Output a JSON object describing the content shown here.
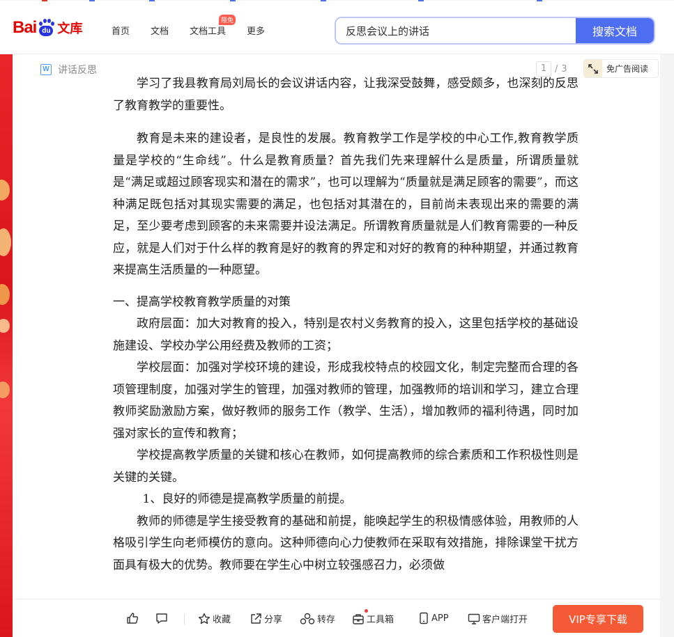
{
  "header": {
    "logo_bai": "Bai",
    "logo_du": "du",
    "logo_wenku": "文库",
    "nav": [
      {
        "label": "首页"
      },
      {
        "label": "文档"
      },
      {
        "label": "文档工具",
        "badge": "限免"
      },
      {
        "label": "更多"
      }
    ],
    "search": {
      "value": "反思会议上的讲话",
      "button": "搜索文档"
    }
  },
  "subbar": {
    "doc_icon": "W",
    "doc_title": "讲话反思",
    "page_current": "1",
    "page_sep": "/",
    "page_total": "3",
    "no_ad_label": "免广告阅读"
  },
  "document": {
    "p0": "学习了我县教育局刘局长的会议讲话内容，让我深受鼓舞，感受颇多，也深刻的反思了教育教学的重要性。",
    "p1": "教育是未来的建设者，是良性的发展。教育教学工作是学校的中心工作,教育教学质量是学校的“生命线”。什么是教育质量？首先我们先来理解什么是质量，所谓质量就是“满足或超过顾客现实和潜在的需求”，也可以理解为“质量就是满足顾客的需要”，而这种满足既包括对其现实需要的满足，也包括对其潜在的，目前尚未表现出来的需要的满足，至少要考虑到顾客的未来需要并设法满足。所谓教育质量就是人们教育需要的一种反应，就是人们对于什么样的教育是好的教育的界定和对好的教育的种种期望，并通过教育来提高生活质量的一种愿望。",
    "h1": "一、提高学校教育教学质量的对策",
    "p2": "政府层面：加大对教育的投入，特别是农村义务教育的投入，这里包括学校的基础设施建设、学校办学公用经费及教师的工资；",
    "p3": "学校层面：加强对学校环境的建设，形成我校特点的校园文化，制定完整而合理的各项管理制度，加强对学生的管理，加强对教师的管理，加强教师的培训和学习，建立合理教师奖励激励方案，做好教师的服务工作（教学、生活），增加教师的福利待遇，同时加强对家长的宣传和教育；",
    "p4": "学校提高教学质量的关键和核心在教师，如何提高教师的综合素质和工作积极性则是关键的关键。",
    "p5": "1、良好的师德是提高教学质量的前提。",
    "p6": "教师的师德是学生接受教育的基础和前提，能唤起学生的积极情感体验，用教师的人格吸引学生向老师模仿的意向。这种师德向心力使教师在采取有效措施，排除课堂干扰方面具有极大的优势。教师要在学生心中树立较强感召力，必须做"
  },
  "toolbar": {
    "like_icon": "thumbs-up-icon",
    "comment_icon": "comment-icon",
    "collect": "收藏",
    "share": "分享",
    "repost": "转存",
    "tools": "工具箱",
    "app": "APP",
    "client": "客户端打开",
    "vip_download": "VIP专享下载"
  },
  "colors": {
    "brand_red": "#e10602",
    "brand_blue": "#2932e1",
    "search_blue": "#4e6ef2",
    "vip_orange": "#f45a35",
    "side_red": "#e8262a"
  }
}
